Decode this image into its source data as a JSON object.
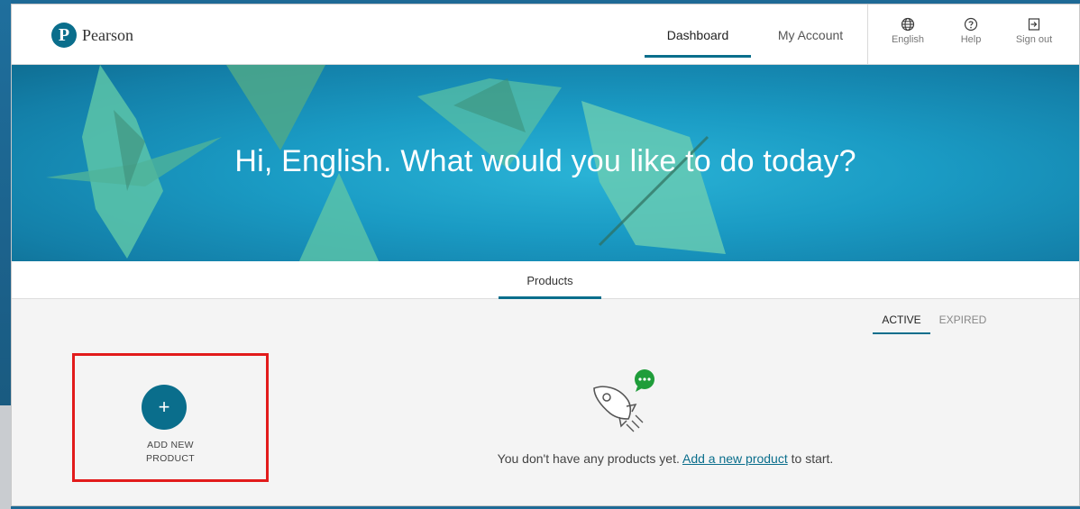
{
  "header": {
    "logo_letter": "P",
    "logo_text": "Pearson",
    "nav": {
      "dashboard": "Dashboard",
      "my_account": "My Account"
    },
    "utilities": {
      "language": "English",
      "help": "Help",
      "sign_out": "Sign out"
    }
  },
  "hero": {
    "greeting": "Hi, English. What would you like to do today?"
  },
  "tabs": {
    "products": "Products"
  },
  "filters": {
    "active": "ACTIVE",
    "expired": "EXPIRED"
  },
  "add_card": {
    "plus": "+",
    "line1": "ADD NEW",
    "line2": "PRODUCT"
  },
  "empty_state": {
    "before": "You don't have any products yet. ",
    "link": "Add a new product",
    "after": " to start."
  },
  "colors": {
    "accent": "#0a6e8c",
    "highlight": "#e21b1b",
    "badge": "#1f9d3a"
  },
  "icons": [
    "globe-icon",
    "help-icon",
    "sign-out-icon",
    "rocket-icon",
    "chat-bubble-icon"
  ]
}
